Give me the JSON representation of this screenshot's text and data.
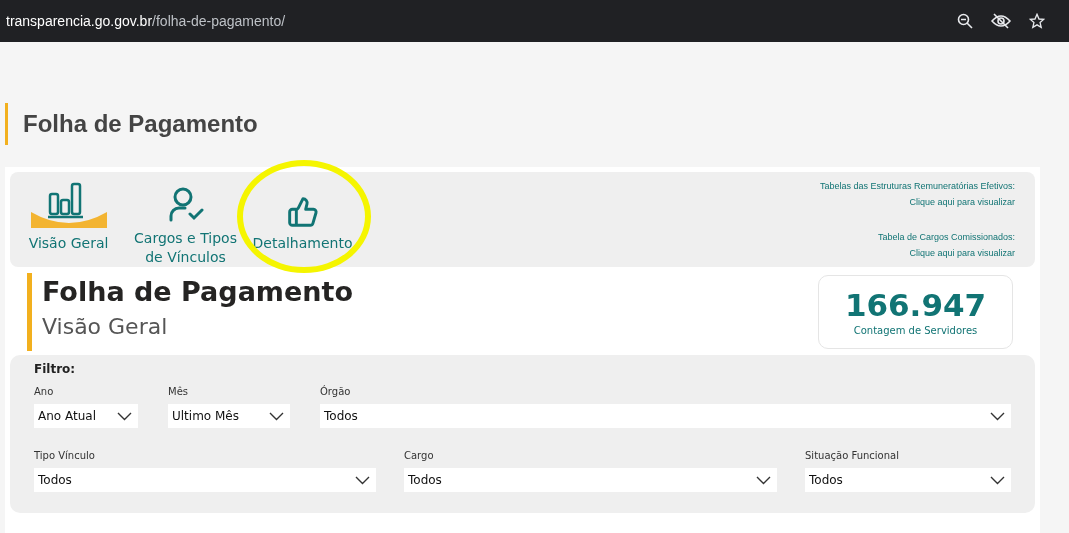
{
  "address_bar": {
    "domain": "transparencia.go.gov.br",
    "path": "/folha-de-pagamento/"
  },
  "page_title": "Folha de Pagamento",
  "nav": [
    {
      "kind": "chart",
      "label": "Visão Geral",
      "highlighted": false
    },
    {
      "kind": "person",
      "label": "Cargos e Tipos de Vínculos",
      "highlighted": false
    },
    {
      "kind": "thumb",
      "label": "Detalhamento",
      "highlighted": true
    }
  ],
  "links": [
    {
      "label": "Tabelas das Estruturas Remuneratórias Efetivos:",
      "link": "Clique aqui para visualizar"
    },
    {
      "label": "Tabela de Cargos Comissionados:",
      "link": "Clique aqui para visualizar"
    }
  ],
  "report_title": "Folha de Pagamento",
  "report_subtitle": "Visão Geral",
  "kpi": {
    "value": "166.947",
    "label": "Contagem de Servidores"
  },
  "filter": {
    "title": "Filtro:",
    "rows": [
      [
        {
          "label": "Ano",
          "value": "Ano Atual"
        },
        {
          "label": "Mês",
          "value": "Ultimo Mês"
        },
        {
          "label": "Órgão",
          "value": "Todos"
        }
      ],
      [
        {
          "label": "Tipo Vínculo",
          "value": "Todos"
        },
        {
          "label": "Cargo",
          "value": "Todos"
        },
        {
          "label": "Situação Funcional",
          "value": "Todos"
        }
      ]
    ]
  }
}
